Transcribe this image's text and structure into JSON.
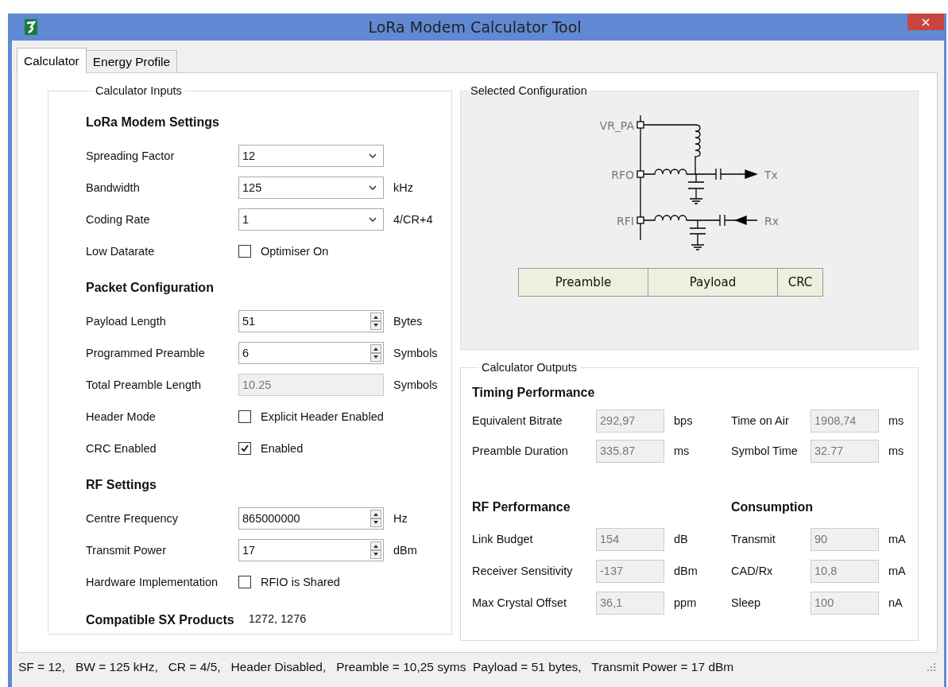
{
  "window": {
    "title": "LoRa Modem Calculator Tool"
  },
  "tabs": [
    {
      "label": "Calculator",
      "selected": true
    },
    {
      "label": "Energy Profile",
      "selected": false
    }
  ],
  "inputs": {
    "title": "Calculator Inputs",
    "sections": [
      {
        "heading": "LoRa Modem Settings",
        "rows": [
          {
            "label": "Spreading Factor",
            "kind": "combo",
            "value": "12"
          },
          {
            "label": "Bandwidth",
            "kind": "combo",
            "value": "125",
            "unit": "kHz"
          },
          {
            "label": "Coding Rate",
            "kind": "combo",
            "value": "1",
            "unit": "4/CR+4"
          },
          {
            "label": "Low Datarate",
            "kind": "check",
            "checked": false,
            "text": "Optimiser On"
          }
        ]
      },
      {
        "heading": "Packet Configuration",
        "rows": [
          {
            "label": "Payload Length",
            "kind": "spin",
            "value": "51",
            "unit": "Bytes"
          },
          {
            "label": "Programmed Preamble",
            "kind": "spin",
            "value": "6",
            "unit": "Symbols"
          },
          {
            "label": "Total Preamble Length",
            "kind": "readonly",
            "value": "10.25",
            "unit": "Symbols"
          },
          {
            "label": "Header Mode",
            "kind": "check",
            "checked": false,
            "text": "Explicit Header Enabled"
          },
          {
            "label": "CRC Enabled",
            "kind": "check",
            "checked": true,
            "text": "Enabled"
          }
        ]
      },
      {
        "heading": "RF Settings",
        "rows": [
          {
            "label": "Centre Frequency",
            "kind": "spin",
            "value": "865000000",
            "unit": "Hz"
          },
          {
            "label": "Transmit Power",
            "kind": "spin",
            "value": "17",
            "unit": "dBm"
          },
          {
            "label": "Hardware Implementation",
            "kind": "check",
            "checked": false,
            "text": "RFIO is Shared"
          }
        ]
      }
    ],
    "compatible": {
      "label": "Compatible SX Products",
      "value": "1272, 1276"
    }
  },
  "selected_config": {
    "title": "Selected Configuration",
    "pins": [
      "VR_PA",
      "RFO",
      "RFI"
    ],
    "ports": [
      "Tx",
      "Rx"
    ],
    "packet": [
      "Preamble",
      "Payload",
      "CRC"
    ]
  },
  "outputs": {
    "title": "Calculator Outputs",
    "timing": {
      "heading": "Timing Performance",
      "rows": [
        [
          {
            "label": "Equivalent Bitrate",
            "value": "292,97",
            "unit": "bps"
          },
          {
            "label": "Time on Air",
            "value": "1908,74",
            "unit": "ms"
          }
        ],
        [
          {
            "label": "Preamble Duration",
            "value": "335.87",
            "unit": "ms"
          },
          {
            "label": "Symbol Time",
            "value": "32.77",
            "unit": "ms"
          }
        ]
      ]
    },
    "columns": [
      {
        "heading": "RF Performance",
        "rows": [
          {
            "label": "Link Budget",
            "value": "154",
            "unit": "dB"
          },
          {
            "label": "Receiver Sensitivity",
            "value": "-137",
            "unit": "dBm"
          },
          {
            "label": "Max Crystal Offset",
            "value": "36,1",
            "unit": "ppm"
          }
        ]
      },
      {
        "heading": "Consumption",
        "rows": [
          {
            "label": "Transmit",
            "value": "90",
            "unit": "mA"
          },
          {
            "label": "CAD/Rx",
            "value": "10,8",
            "unit": "mA"
          },
          {
            "label": "Sleep",
            "value": "100",
            "unit": "nA"
          }
        ]
      }
    ]
  },
  "status_bar": "SF = 12,   BW = 125 kHz,   CR = 4/5,   Header Disabled,   Preamble = 10,25 syms  Payload = 51 bytes,   Transmit Power = 17 dBm"
}
